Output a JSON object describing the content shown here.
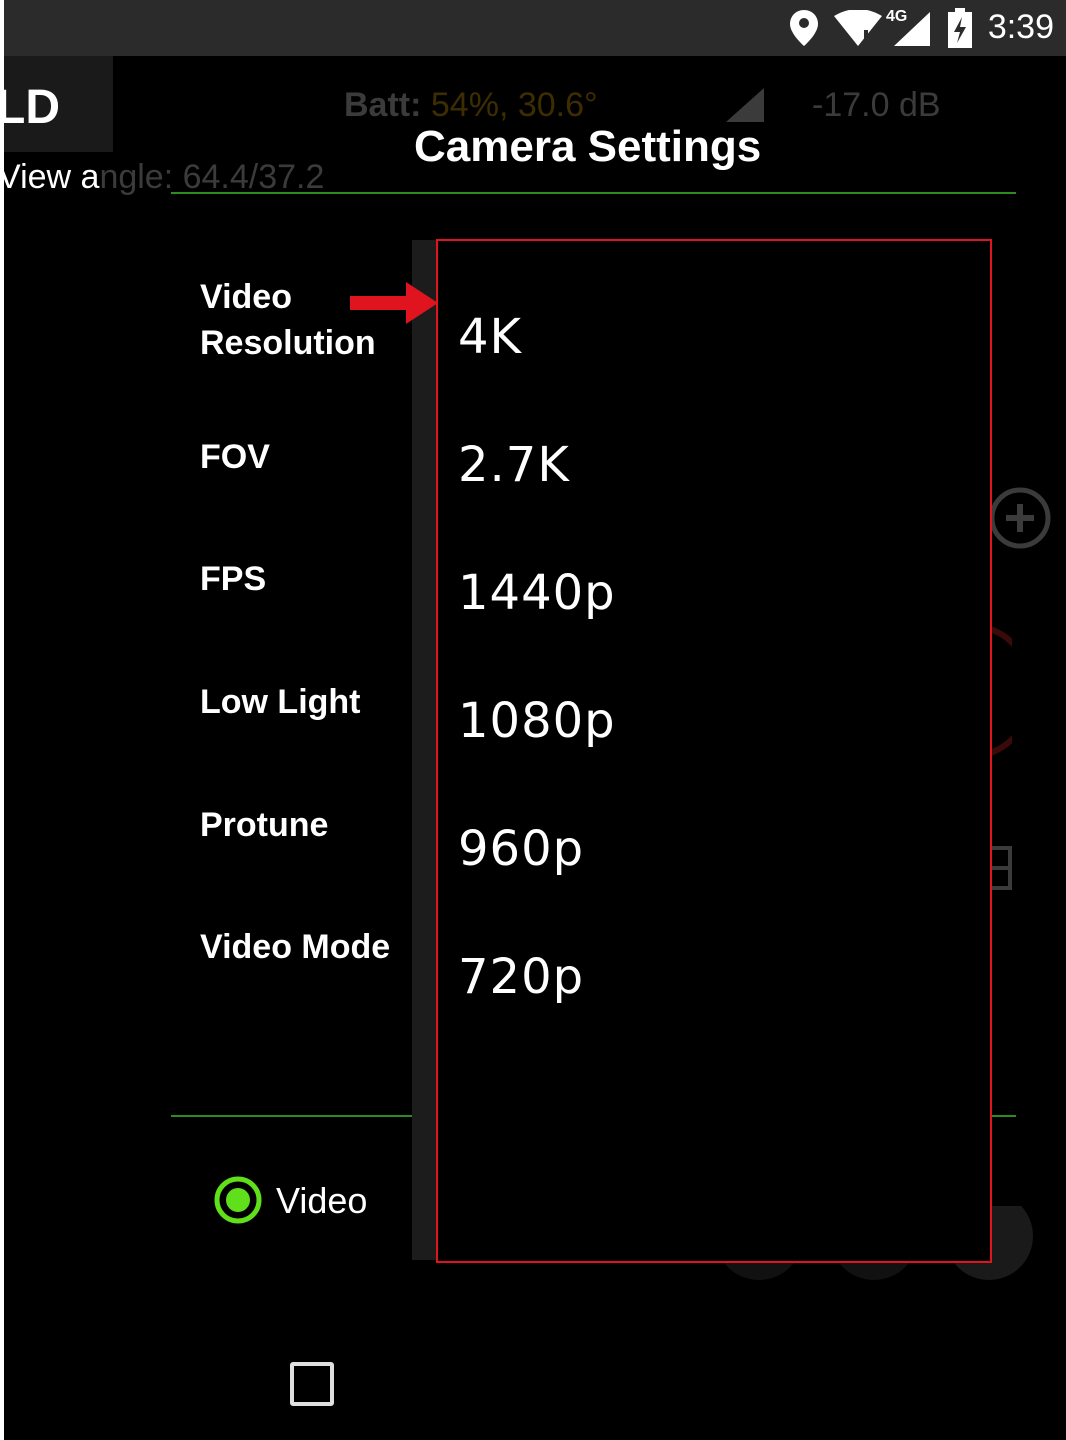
{
  "status_bar": {
    "time": "3:39",
    "network": "4G",
    "icons": [
      "location-icon",
      "wifi-icon",
      "cell-signal-icon",
      "battery-charging-icon"
    ]
  },
  "background_app": {
    "title_fragment": "LD",
    "view_angle_prefix": "View a",
    "view_angle_rest": "ngle: 64.4/37.2",
    "batt_label": "Batt:",
    "batt_value": "54%, 30.6°",
    "signal": "-17.0 dB"
  },
  "dialog": {
    "title": "Camera Settings",
    "settings": [
      {
        "label": "Video\nResolution"
      },
      {
        "label": "FOV"
      },
      {
        "label": "FPS"
      },
      {
        "label": "Low Light"
      },
      {
        "label": "Protune"
      },
      {
        "label": "Video Mode"
      }
    ],
    "mode_radio": {
      "label": "Video",
      "selected": true
    }
  },
  "resolution_dropdown": {
    "options": [
      "4K",
      "2.7K",
      "1440p",
      "1080p",
      "960p",
      "720p"
    ]
  },
  "colors": {
    "accent_green": "#2e8b1f",
    "radio_green": "#5fe01a",
    "highlight_red": "#e0141e"
  }
}
